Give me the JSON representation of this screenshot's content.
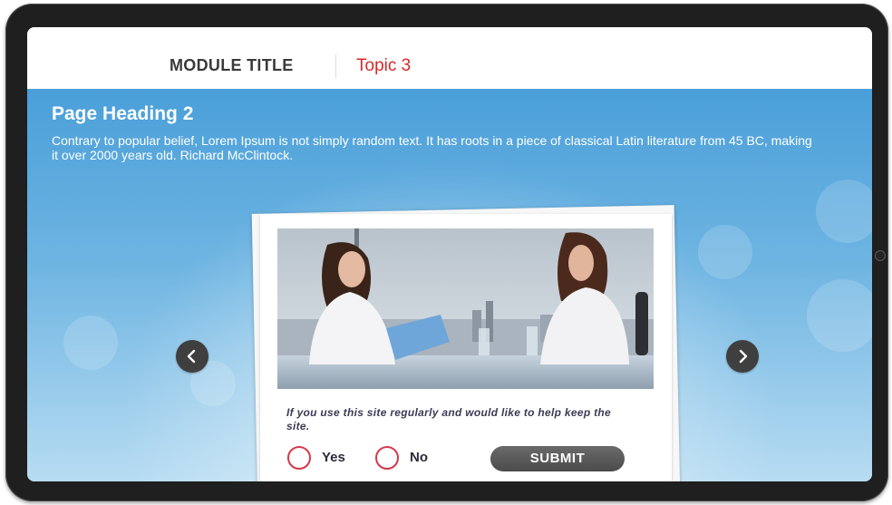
{
  "header": {
    "module_title": "MODULE TITLE",
    "topic": "Topic 3"
  },
  "page": {
    "heading": "Page Heading 2",
    "body": "Contrary to popular belief, Lorem Ipsum is not simply random text. It has roots in a piece of classical Latin literature from 45 BC, making it over 2000 years old. Richard McClintock."
  },
  "card": {
    "image_icon": "office-meeting-photo",
    "question": "If you use this site regularly and would like to help keep the site.",
    "options": [
      "Yes",
      "No"
    ],
    "submit_label": "SUBMIT"
  },
  "navigation": {
    "prev_icon": "chevron-left-icon",
    "next_icon": "chevron-right-icon"
  },
  "colors": {
    "topic_red": "#d62828",
    "radio_red": "#d6394b",
    "sky_blue": "#4a9fd9",
    "button_gray": "#555555"
  }
}
